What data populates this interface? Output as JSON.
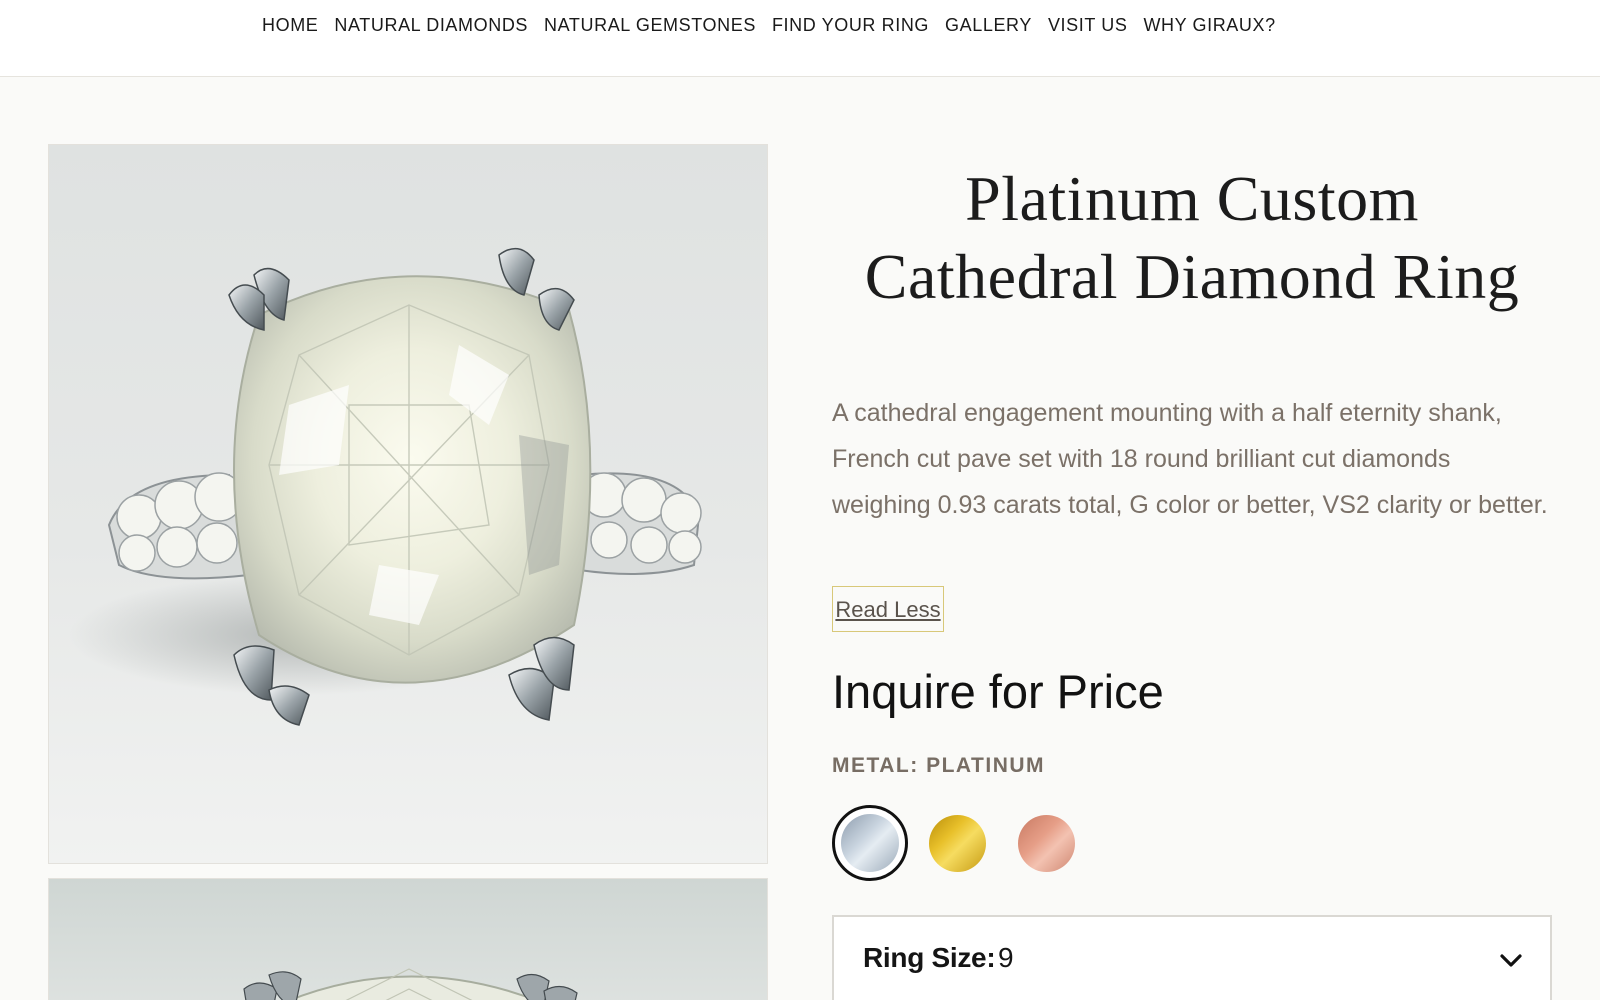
{
  "nav": {
    "items": [
      {
        "label": "HOME"
      },
      {
        "label": "NATURAL DIAMONDS"
      },
      {
        "label": "NATURAL GEMSTONES"
      },
      {
        "label": "FIND YOUR RING"
      },
      {
        "label": "GALLERY"
      },
      {
        "label": "VISIT US"
      },
      {
        "label": "WHY GIRAUX?"
      }
    ]
  },
  "product": {
    "title": "Platinum Custom Cathedral Diamond Ring",
    "description": "A cathedral engagement mounting with a half eternity shank, French cut pave set with 18 round brilliant cut diamonds weighing 0.93 carats total, G color or better, VS2 clarity or better.",
    "read_toggle_label": "Read Less",
    "price_label": "Inquire for Price",
    "metal_label": "METAL: PLATINUM",
    "metal_options": [
      {
        "name": "platinum",
        "selected": true,
        "color": "#b7c3cf"
      },
      {
        "name": "yellow-gold",
        "selected": false,
        "color": "#dcb21f"
      },
      {
        "name": "rose-gold",
        "selected": false,
        "color": "#df9a85"
      }
    ],
    "ring_size": {
      "label": "Ring Size:",
      "value": "9"
    }
  },
  "images": {
    "main_alt": "cushion cut diamond ring",
    "thumbnail_alt": "ring"
  }
}
